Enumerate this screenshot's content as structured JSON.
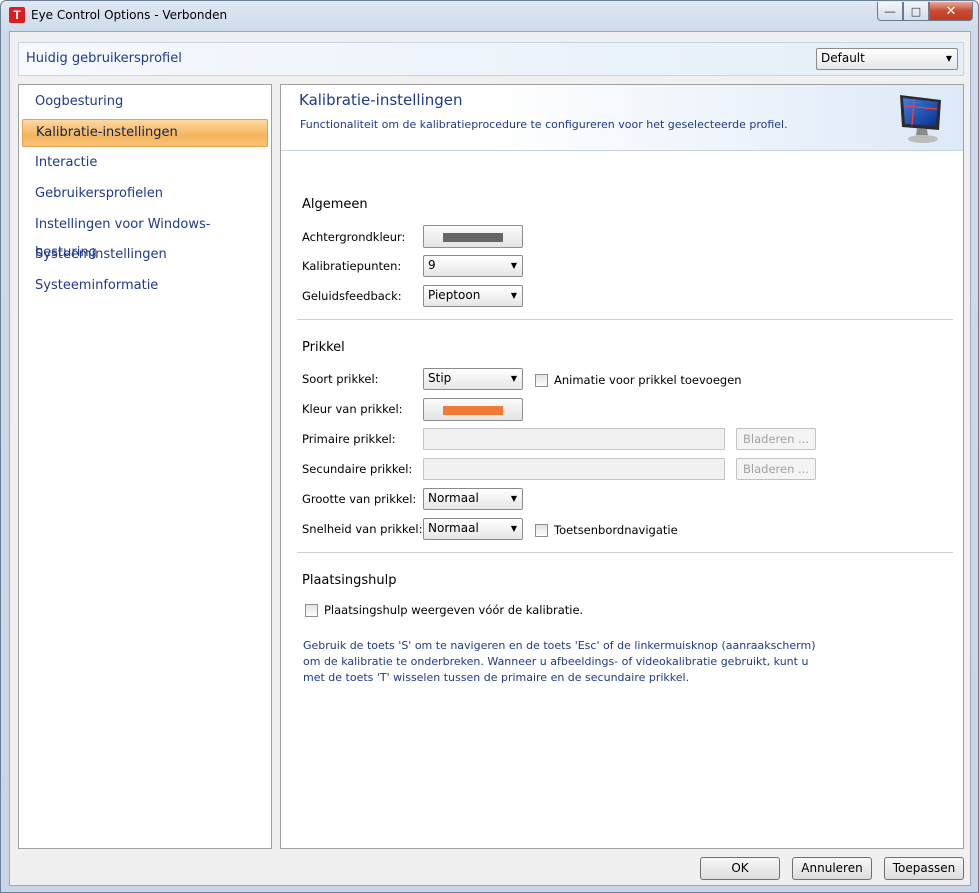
{
  "window": {
    "app_icon_letter": "T",
    "title": "Eye Control Options - Verbonden",
    "minimize": "―",
    "maximize": "□",
    "close": "✕"
  },
  "profile": {
    "label": "Huidig gebruikersprofiel",
    "selected": "Default"
  },
  "nav": {
    "items": [
      {
        "label": "Oogbesturing",
        "active": false
      },
      {
        "label": "Kalibratie-instellingen",
        "active": true
      },
      {
        "label": "Interactie",
        "active": false
      },
      {
        "label": "Gebruikersprofielen",
        "active": false
      },
      {
        "label": "Instellingen voor Windows-besturing",
        "active": false
      },
      {
        "label": "Systeeminstellingen",
        "active": false
      },
      {
        "label": "Systeeminformatie",
        "active": false
      }
    ]
  },
  "header": {
    "title": "Kalibratie-instellingen",
    "subtitle": "Functionaliteit om de kalibratieprocedure te configureren voor het geselecteerde profiel."
  },
  "general": {
    "title": "Algemeen",
    "background_color_label": "Achtergrondkleur:",
    "background_color": "#666666",
    "points_label": "Kalibratiepunten:",
    "points_value": "9",
    "sound_label": "Geluidsfeedback:",
    "sound_value": "Pieptoon"
  },
  "stimulus": {
    "title": "Prikkel",
    "type_label": "Soort prikkel:",
    "type_value": "Stip",
    "animation_label": "Animatie voor prikkel toevoegen",
    "animation_checked": false,
    "color_label": "Kleur van prikkel:",
    "color": "#ef7b35",
    "primary_label": "Primaire prikkel:",
    "primary_value": "",
    "primary_browse": "Bladeren ...",
    "secondary_label": "Secundaire prikkel:",
    "secondary_value": "",
    "secondary_browse": "Bladeren ...",
    "size_label": "Grootte van prikkel:",
    "size_value": "Normaal",
    "speed_label": "Snelheid van prikkel:",
    "speed_value": "Normaal",
    "keyboard_nav_label": "Toetsenbordnavigatie",
    "keyboard_nav_checked": false
  },
  "placement": {
    "title": "Plaatsingshulp",
    "checkbox_label": "Plaatsingshulp weergeven vóór de kalibratie.",
    "checked": false,
    "info_text": "Gebruik de toets 'S' om te navigeren en de toets 'Esc' of de linkermuisknop (aanraakscherm) om de kalibratie te onderbreken. Wanneer u afbeeldings- of videokalibratie gebruikt, kunt u met de toets 'T' wisselen tussen de primaire en de secundaire prikkel."
  },
  "footer": {
    "ok": "OK",
    "cancel": "Annuleren",
    "apply": "Toepassen"
  }
}
